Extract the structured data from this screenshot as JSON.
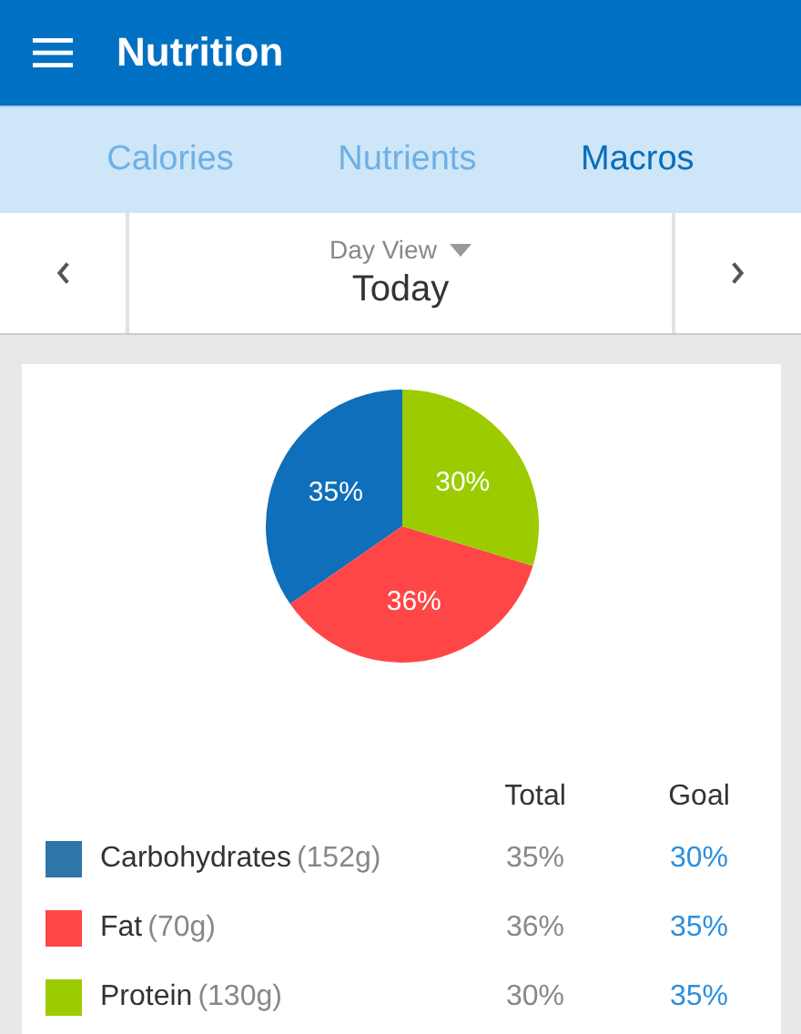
{
  "app_bar": {
    "title": "Nutrition"
  },
  "tabs": [
    {
      "label": "Calories",
      "selected": false
    },
    {
      "label": "Nutrients",
      "selected": false
    },
    {
      "label": "Macros",
      "selected": true
    }
  ],
  "day_nav": {
    "view_label": "Day View",
    "date": "Today"
  },
  "chart_data": {
    "type": "pie",
    "categories": [
      "Carbohydrates",
      "Fat",
      "Protein"
    ],
    "values": [
      35,
      36,
      30
    ],
    "value_labels": [
      "35%",
      "36%",
      "30%"
    ]
  },
  "table": {
    "columns": [
      "Total",
      "Goal"
    ],
    "rows": [
      {
        "amount": "(152g)",
        "total": "35%",
        "goal": "30%",
        "color": "#2e75aa"
      },
      {
        "amount": "(70g)",
        "total": "36%",
        "goal": "35%",
        "color": "#ff4646"
      },
      {
        "amount": "(130g)",
        "total": "30%",
        "goal": "35%",
        "color": "#9ccc00"
      }
    ]
  }
}
